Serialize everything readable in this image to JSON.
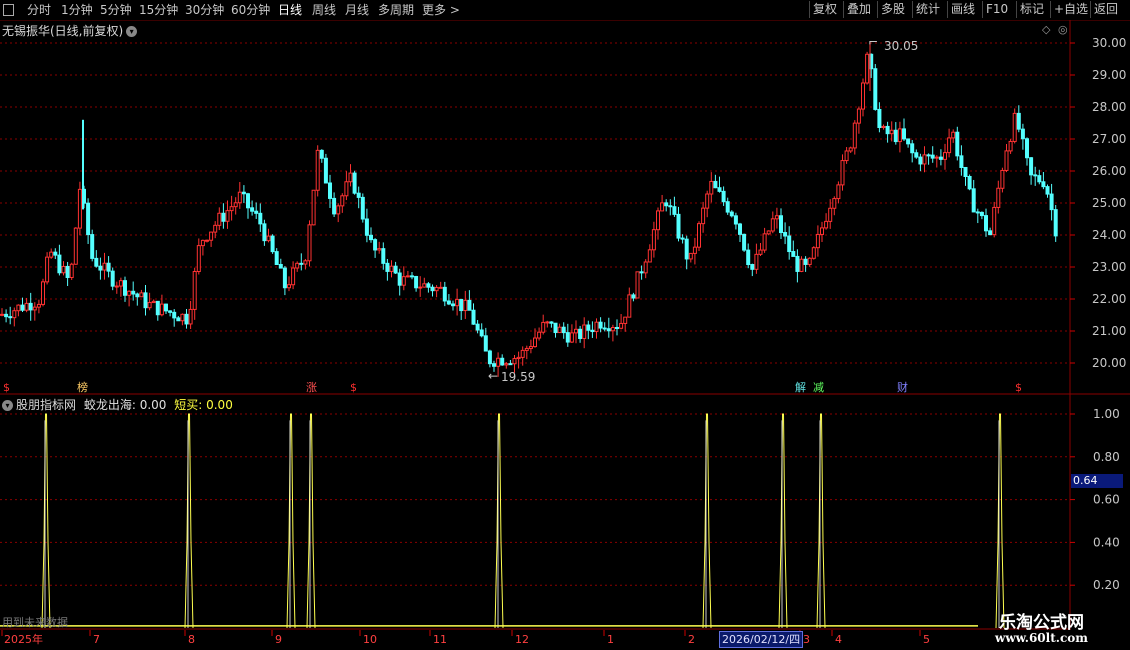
{
  "toolbar": {
    "left": [
      "分时",
      "1分钟",
      "5分钟",
      "15分钟",
      "30分钟",
      "60分钟",
      "日线",
      "周线",
      "月线",
      "多周期",
      "更多 >"
    ],
    "active": "日线",
    "right": [
      "复权",
      "叠加",
      "多股",
      "统计",
      "画线",
      "F10",
      "标记",
      "+自选",
      "返回"
    ]
  },
  "chart": {
    "title": "无锡振华(日线,前复权)",
    "high_label": "30.05",
    "low_label": "19.59",
    "y_axis": [
      "30.00",
      "29.00",
      "28.00",
      "27.00",
      "26.00",
      "25.00",
      "24.00",
      "23.00",
      "22.00",
      "21.00",
      "20.00"
    ]
  },
  "markers": [
    {
      "text": "$",
      "color": "#ff3030",
      "x": 8
    },
    {
      "text": "榜",
      "color": "#ffcc66",
      "x": 82
    },
    {
      "text": "涨",
      "color": "#ff5050",
      "x": 311
    },
    {
      "text": "$",
      "color": "#ff3030",
      "x": 355
    },
    {
      "text": "解",
      "color": "#60e0e0",
      "x": 800
    },
    {
      "text": "减",
      "color": "#60ff60",
      "x": 818
    },
    {
      "text": "财",
      "color": "#8080ff",
      "x": 902
    },
    {
      "text": "$",
      "color": "#ff3030",
      "x": 1020
    }
  ],
  "indicator": {
    "name": "股朋指标网",
    "series": [
      {
        "label": "蛟龙出海: 0.00",
        "color": "#e0e0e0"
      },
      {
        "label": "短买: 0.00",
        "color": "#ffff40"
      }
    ],
    "y_axis": [
      "1.00",
      "0.80",
      "0.60",
      "0.40",
      "0.20"
    ],
    "current": "0.64",
    "future_text": "用到未来数据"
  },
  "x_axis": [
    "2025年",
    "7",
    "8",
    "9",
    "10",
    "11",
    "12",
    "1",
    "2",
    "3",
    "4",
    "5"
  ],
  "cursor_date": "2026/02/12/四",
  "logo": {
    "cn": "乐淘公式网",
    "url": "www.60lt.com"
  },
  "colors": {
    "up": "#ff3232",
    "down": "#54ffff",
    "grid": "#8a0000",
    "signal": "#ffff50"
  }
}
